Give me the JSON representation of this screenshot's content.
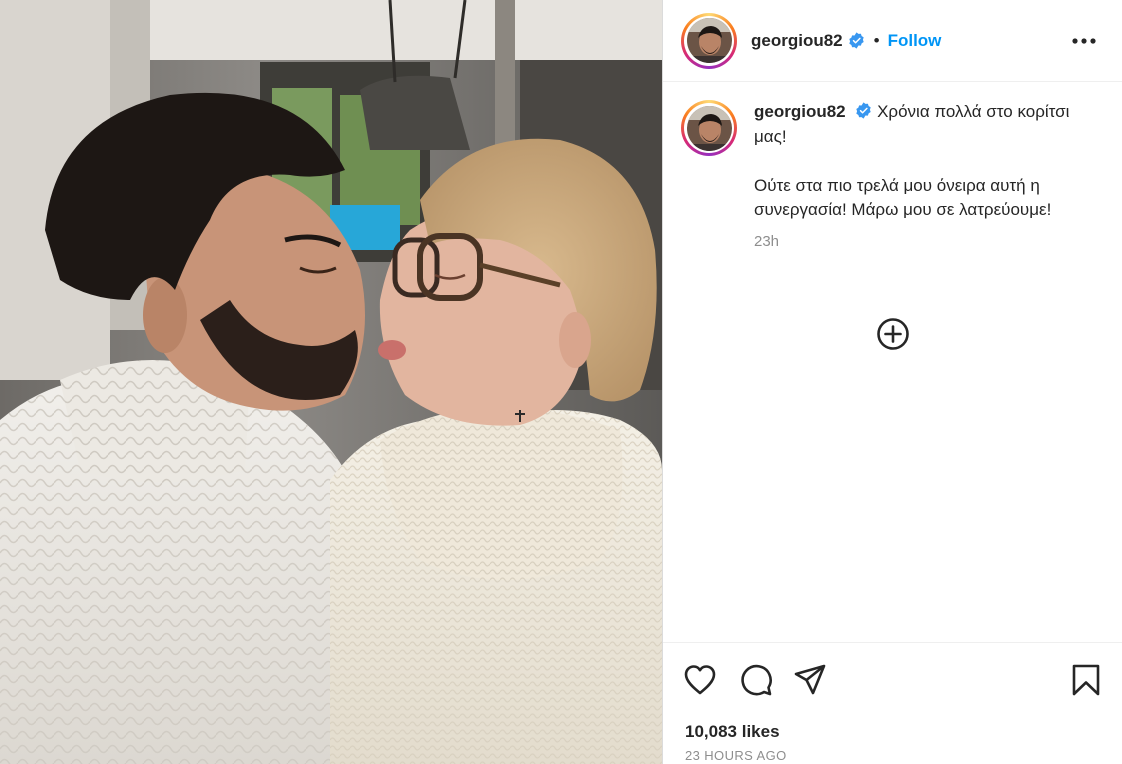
{
  "post": {
    "image_alt": "Man in white cable-knit turtleneck and older woman with glasses in white turtleneck kissing",
    "author": {
      "username": "georgiou82",
      "verified": true
    },
    "header": {
      "separator": "•",
      "follow_label": "Follow",
      "more_icon": "more-options-icon"
    },
    "caption": {
      "line1": "Χρόνια πολλά στο κορίτσι μας!",
      "line2": "Ούτε στα πιο τρελά μου όνειρα αυτή η συνεργασία! Μάρω μου σε λατρεύουμε!",
      "time_ago": "23h"
    },
    "actions": {
      "like_icon": "heart-icon",
      "comment_icon": "comment-icon",
      "share_icon": "share-icon",
      "save_icon": "bookmark-icon",
      "load_more_icon": "plus-circle-icon"
    },
    "likes_text": "10,083 likes",
    "posted_text": "23 HOURS AGO",
    "colors": {
      "follow": "#0095f6",
      "verified": "#3897f0",
      "muted": "#8e8e8e",
      "text": "#262626"
    }
  }
}
